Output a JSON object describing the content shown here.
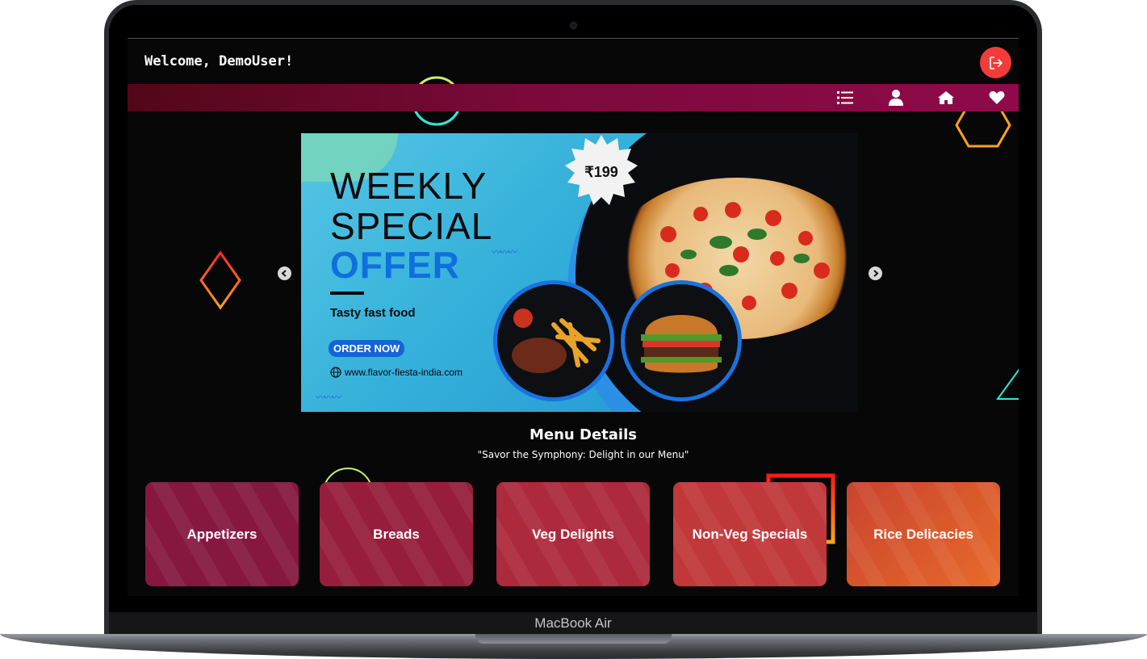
{
  "header": {
    "welcome_text": "Welcome, DemoUser!",
    "logout_icon": "logout-icon",
    "accent_color": "#f23c3c"
  },
  "navbar": {
    "gradient": [
      "#520718",
      "#8e0a4a"
    ],
    "icons": [
      "menu-list-icon",
      "user-icon",
      "home-icon",
      "heart-icon"
    ]
  },
  "carousel": {
    "prev_icon": "chevron-left-icon",
    "next_icon": "chevron-right-icon",
    "slide": {
      "price": "₹199",
      "line1": "WEEKLY",
      "line2": "SPECIAL",
      "line3": "OFFER",
      "tagline": "Tasty fast food",
      "cta": "ORDER NOW",
      "website": "www.flavor-fiesta-india.com"
    }
  },
  "menu": {
    "title": "Menu Details",
    "subtitle": "\"Savor the Symphony: Delight in our Menu\"",
    "categories": [
      {
        "label": "Appetizers",
        "color": "#861840"
      },
      {
        "label": "Breads",
        "color": "#961e3c"
      },
      {
        "label": "Veg Delights",
        "color": "#ac2a3c"
      },
      {
        "label": "Non-Veg Specials",
        "color": "#c0383a"
      },
      {
        "label": "Rice Delicacies",
        "color": "#d65332"
      }
    ]
  },
  "device": {
    "label": "MacBook Air"
  }
}
